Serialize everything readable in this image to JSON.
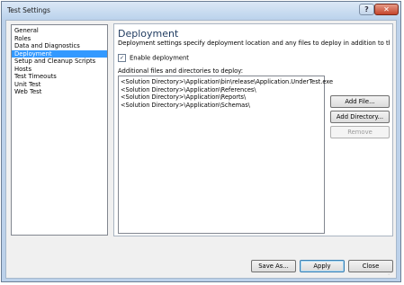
{
  "window": {
    "title": "Test Settings",
    "help_label": "?",
    "close_label": "✕"
  },
  "nav": {
    "items": [
      {
        "label": "General",
        "selected": false
      },
      {
        "label": "Roles",
        "selected": false
      },
      {
        "label": "Data and Diagnostics",
        "selected": false
      },
      {
        "label": "Deployment",
        "selected": true
      },
      {
        "label": "Setup and Cleanup Scripts",
        "selected": false
      },
      {
        "label": "Hosts",
        "selected": false
      },
      {
        "label": "Test Timeouts",
        "selected": false
      },
      {
        "label": "Unit Test",
        "selected": false
      },
      {
        "label": "Web Test",
        "selected": false
      }
    ]
  },
  "panel": {
    "heading": "Deployment",
    "description": "Deployment settings specify deployment location and any files to deploy in addition to the target ...",
    "enable_checkbox": {
      "label": "Enable deployment",
      "checked": true,
      "mark": "✓"
    },
    "files_label": "Additional files and directories to deploy:",
    "files": [
      "<Solution Directory>\\Application\\bin\\release\\Application.UnderTest.exe",
      "<Solution Directory>\\Application\\References\\",
      "<Solution Directory>\\Application\\Reports\\",
      "<Solution Directory>\\Application\\Schemas\\"
    ],
    "add_file_label": "Add File...",
    "add_directory_label": "Add Directory...",
    "remove_label": "Remove"
  },
  "footer": {
    "save_as_label": "Save As...",
    "apply_label": "Apply",
    "close_label": "Close"
  }
}
